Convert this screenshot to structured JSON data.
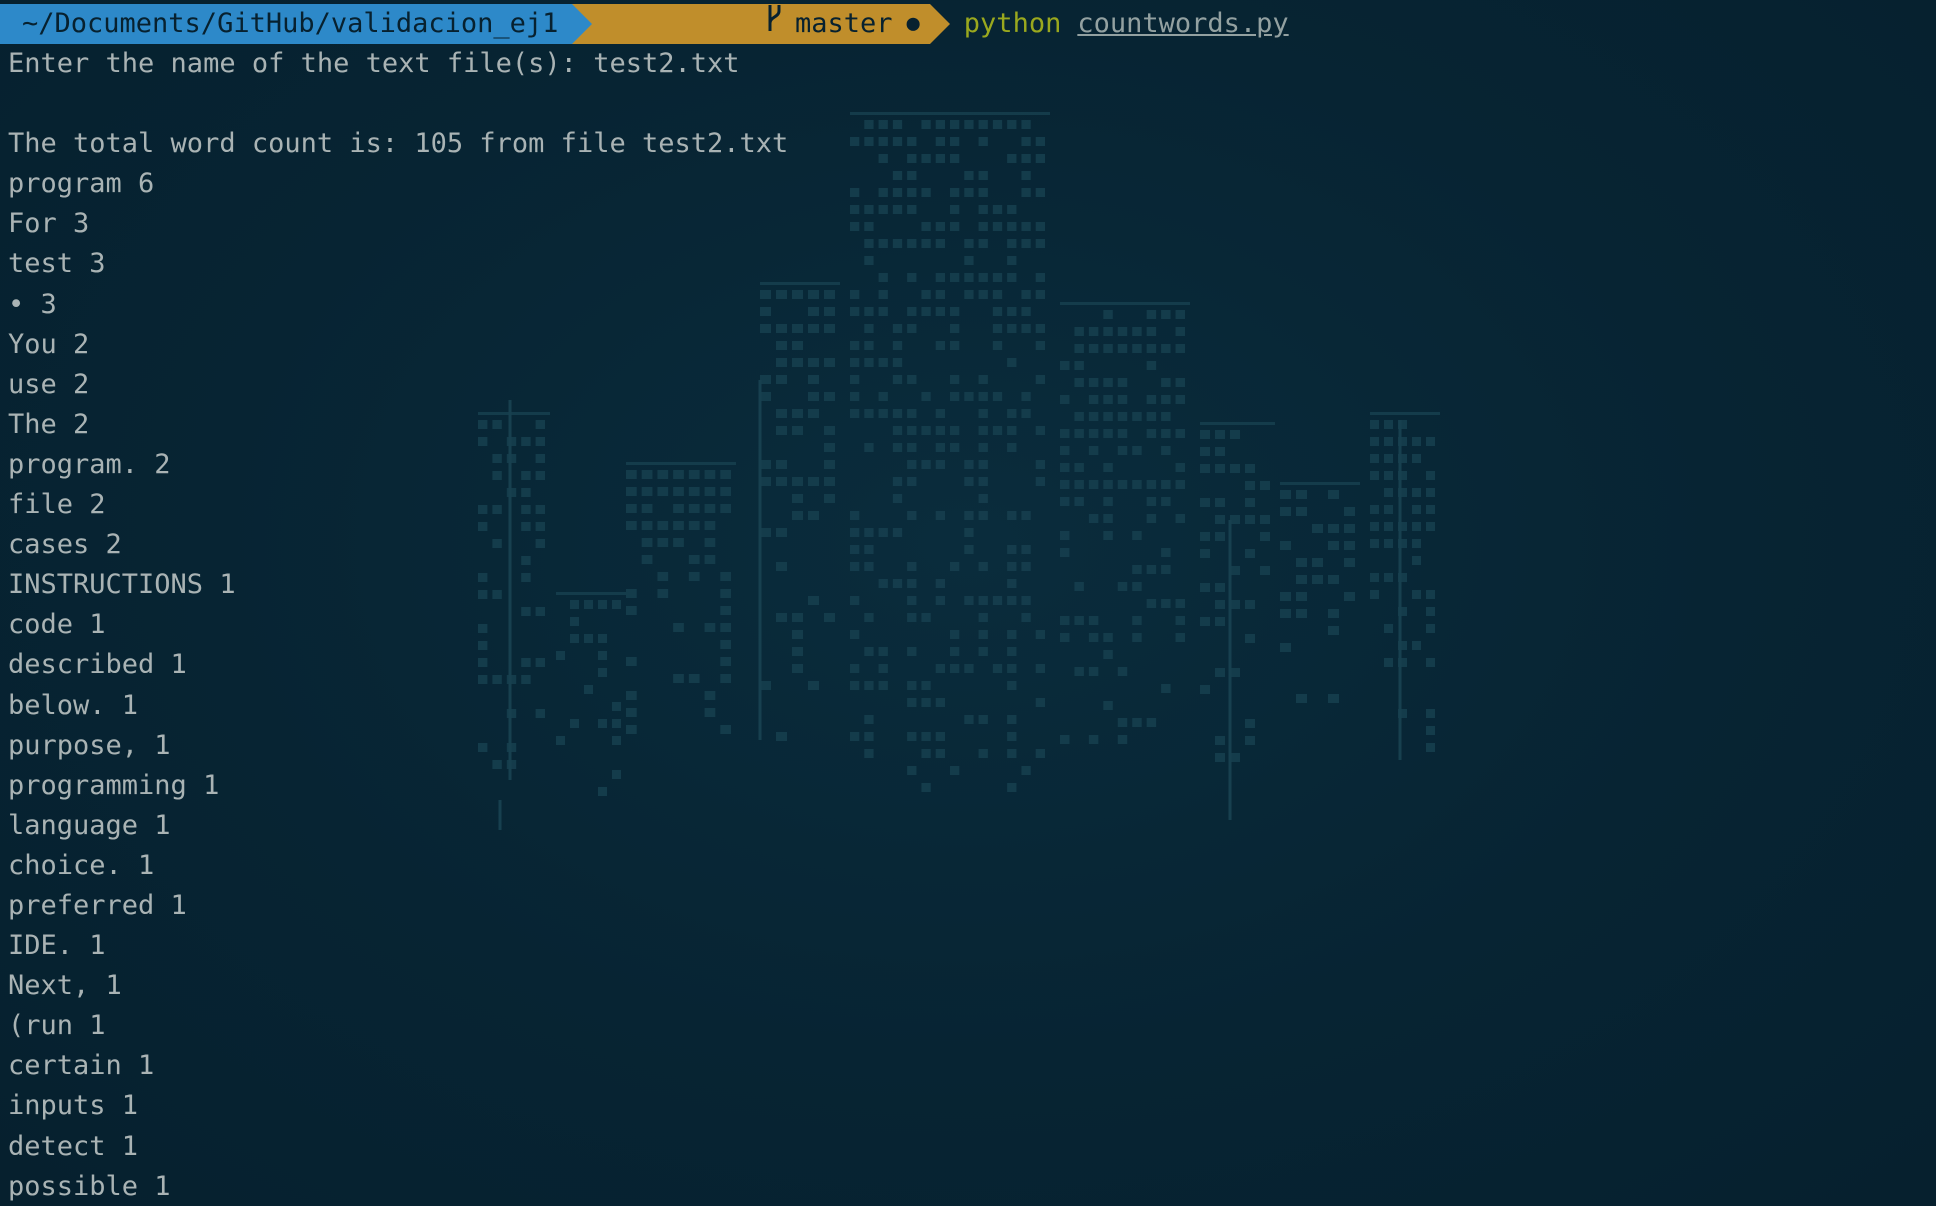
{
  "prompt": {
    "path": "~/Documents/GitHub/validacion_ej1",
    "branch": "master",
    "command": "python",
    "argument": "countwords.py"
  },
  "output": {
    "input_line": "Enter the name of the text file(s): test2.txt",
    "blank": "",
    "total_line": "The total word count is: 105 from file test2.txt",
    "words": [
      "program 6",
      "For 3",
      "test 3",
      "• 3",
      "You 2",
      "use 2",
      "The 2",
      "program. 2",
      "file 2",
      "cases 2",
      "INSTRUCTIONS 1",
      "code 1",
      "described 1",
      "below. 1",
      "purpose, 1",
      "programming 1",
      "language 1",
      "choice. 1",
      "preferred 1",
      "IDE. 1",
      "Next, 1",
      "(run 1",
      "certain 1",
      "inputs 1",
      "detect 1",
      "possible 1"
    ]
  },
  "colors": {
    "background": "#072433",
    "path_segment": "#2d89c9",
    "git_segment": "#c08e2b",
    "command": "#9aa81e",
    "text": "#a9b3b4"
  }
}
